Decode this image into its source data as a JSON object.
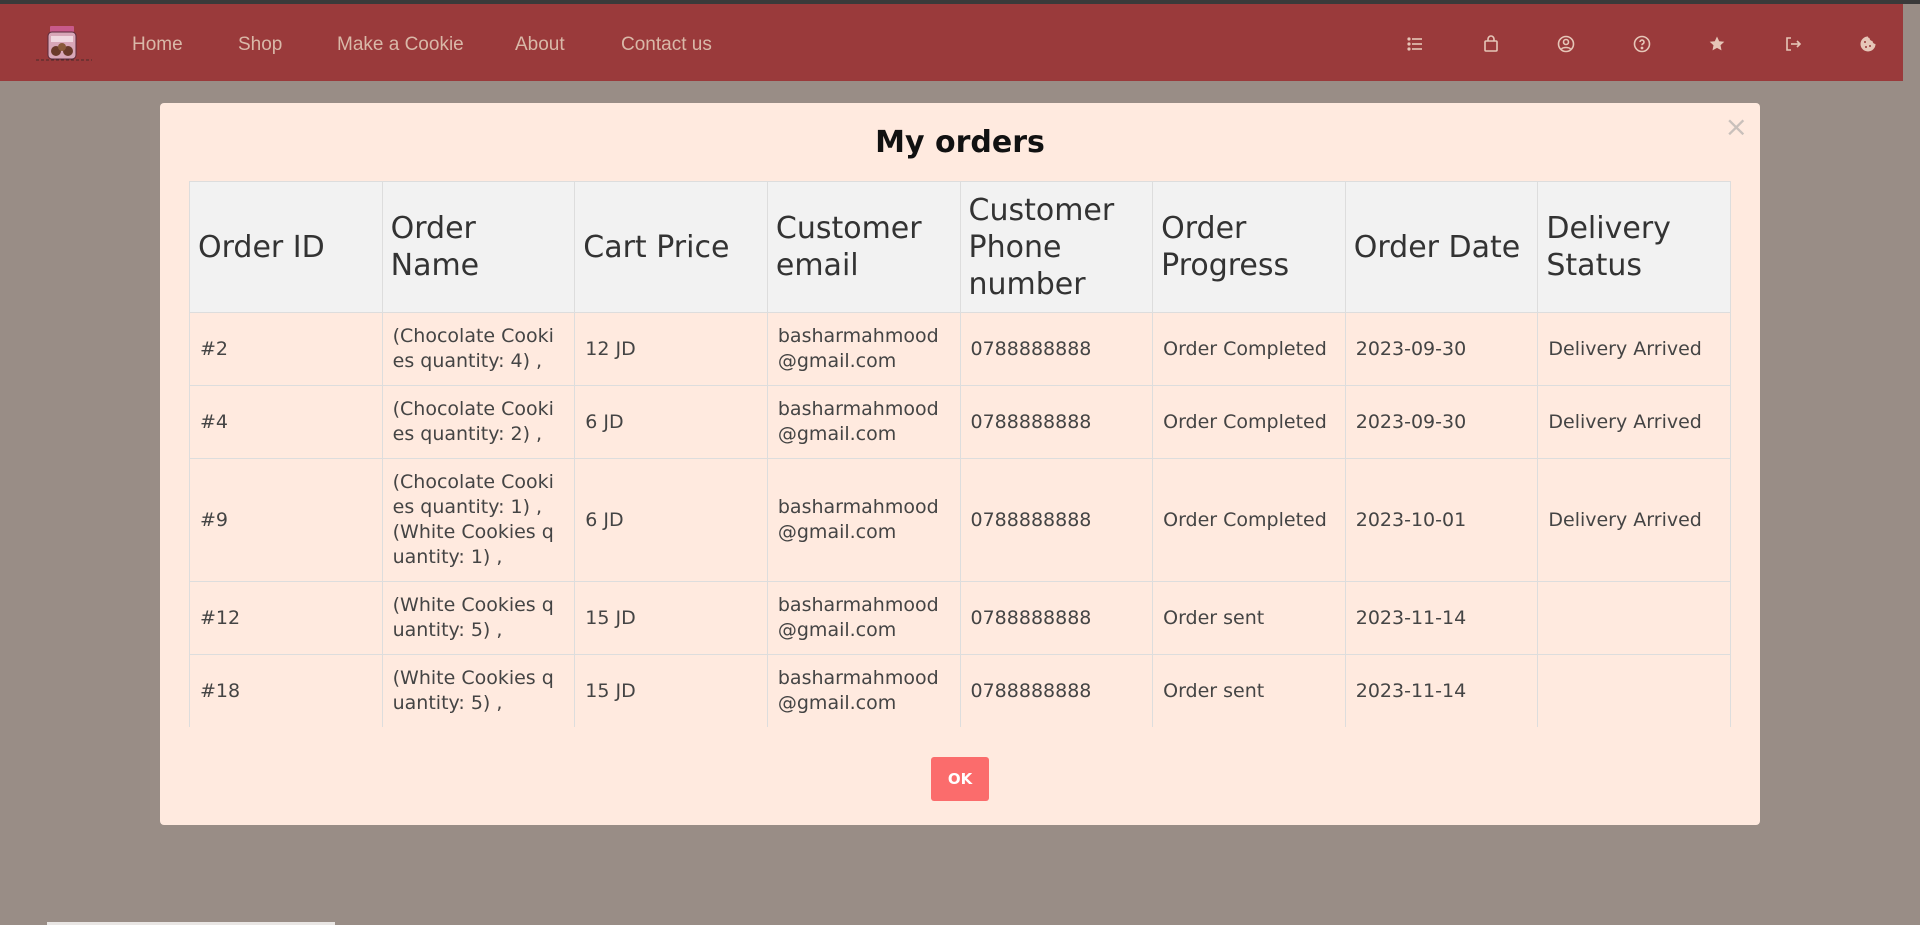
{
  "nav": {
    "links": [
      "Home",
      "Shop",
      "Make a Cookie",
      "About",
      "Contact us"
    ],
    "icons": [
      "list-icon",
      "shopping-bag-icon",
      "user-circle-icon",
      "help-circle-icon",
      "star-icon",
      "logout-icon",
      "cookie-icon"
    ]
  },
  "modal": {
    "title": "My orders",
    "close_label": "×",
    "ok_label": "OK"
  },
  "table": {
    "headers": [
      "Order ID",
      "Order Name",
      "Cart Price",
      "Customer email",
      "Customer Phone number",
      "Order Progress",
      "Order Date",
      "Delivery Status"
    ],
    "rows": [
      [
        "#2",
        "(Chocolate Cookies quantity: 4) ,",
        "12 JD",
        "basharmahmood@gmail.com",
        "0788888888",
        "Order Completed",
        "2023-09-30",
        "Delivery Arrived"
      ],
      [
        "#4",
        "(Chocolate Cookies quantity: 2) ,",
        "6 JD",
        "basharmahmood@gmail.com",
        "0788888888",
        "Order Completed",
        "2023-09-30",
        "Delivery Arrived"
      ],
      [
        "#9",
        "(Chocolate Cookies quantity: 1) ,(White Cookies quantity: 1) ,",
        "6 JD",
        "basharmahmood@gmail.com",
        "0788888888",
        "Order Completed",
        "2023-10-01",
        "Delivery Arrived"
      ],
      [
        "#12",
        "(White Cookies quantity: 5) ,",
        "15 JD",
        "basharmahmood@gmail.com",
        "0788888888",
        "Order sent",
        "2023-11-14",
        ""
      ],
      [
        "#18",
        "(White Cookies quantity: 5) ,",
        "15 JD",
        "basharmahmood@gmail.com",
        "0788888888",
        "Order sent",
        "2023-11-14",
        ""
      ]
    ]
  },
  "colors": {
    "navbar": "#9a3a3b",
    "overlay": "#998d86",
    "modal": "#ffeadf",
    "ok_button": "#fb6c6c"
  }
}
